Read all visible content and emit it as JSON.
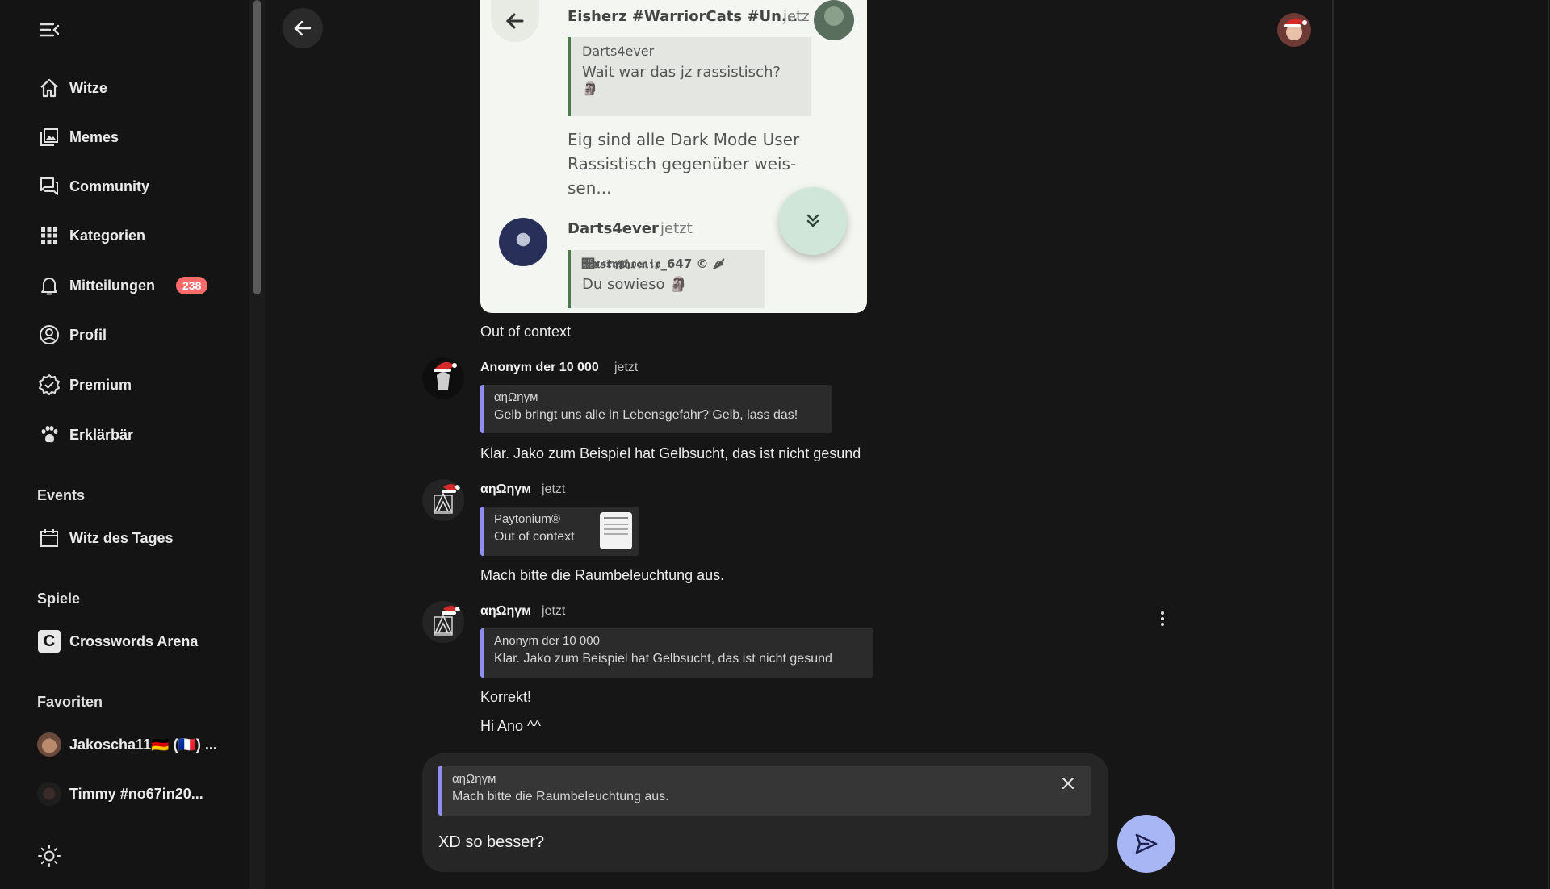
{
  "sidebar": {
    "items": [
      {
        "label": "Witze",
        "icon": "home-icon"
      },
      {
        "label": "Memes",
        "icon": "image-gallery-icon"
      },
      {
        "label": "Community",
        "icon": "chat-icon"
      },
      {
        "label": "Kategorien",
        "icon": "grid-icon"
      },
      {
        "label": "Mitteilungen",
        "icon": "bell-icon",
        "badge": "238"
      },
      {
        "label": "Profil",
        "icon": "user-circle-icon"
      },
      {
        "label": "Premium",
        "icon": "verified-badge-icon"
      },
      {
        "label": "Erklärbär",
        "icon": "paw-icon"
      }
    ],
    "events_title": "Events",
    "events": [
      {
        "label": "Witz des Tages",
        "icon": "calendar-icon"
      }
    ],
    "games_title": "Spiele",
    "games": [
      {
        "label": "Crosswords Arena",
        "icon_letter": "C"
      }
    ],
    "favorites_title": "Favoriten",
    "favorites": [
      {
        "label": "Jakoscha11🇩🇪 (🇫🇷) ..."
      },
      {
        "label": "Timmy #no67in20..."
      }
    ]
  },
  "embedded": {
    "top_name": "Eisherz #WarriorCats #Un...",
    "top_time": "jetz",
    "quote1_author": "Darts4ever",
    "quote1_text": "Wait war das jz rassistisch?",
    "quote1_emoji": "🗿",
    "body_line1": "Eig sind alle Dark Mode User",
    "body_line2": "Rassistisch gegenüber weis-",
    "body_line3": "sen...",
    "second_name": "Darts4ever",
    "second_time": "jetzt",
    "quote2_author": "𝔋𝔲𝔰𝔨𝔶𝔓𝔥𝔬𝔢𝔫𝔦𝔵_647 © 🌶",
    "quote2_text": "Du sowieso 🗿"
  },
  "messages": {
    "caption1": "Out of context",
    "m1": {
      "author": "Anonym der 10 000",
      "time": "jetzt",
      "quote_author": "αηΩηγм",
      "quote_text": "Gelb bringt uns alle in Lebensgefahr? Gelb, lass das!",
      "text": "Klar. Jako zum Beispiel hat Gelbsucht, das ist nicht gesund"
    },
    "m2": {
      "author": "αηΩηγм",
      "time": "jetzt",
      "quote_author": "Paytonium®",
      "quote_text": "Out of context",
      "text": "Mach bitte die Raumbeleuchtung aus."
    },
    "m3": {
      "author": "αηΩηγм",
      "time": "jetzt",
      "quote_author": "Anonym der 10 000",
      "quote_text": "Klar. Jako zum Beispiel hat Gelbsucht, das ist nicht gesund",
      "text1": "Korrekt!",
      "text2": "Hi Ano ^^"
    }
  },
  "composer": {
    "reply_author": "αηΩηγм",
    "reply_text": "Mach bitte die Raumbeleuchtung aus.",
    "value": "XD so besser?"
  },
  "colors": {
    "accent": "#8f8ff0",
    "send_button": "#a9b6f5",
    "badge": "#ff6b6b"
  }
}
